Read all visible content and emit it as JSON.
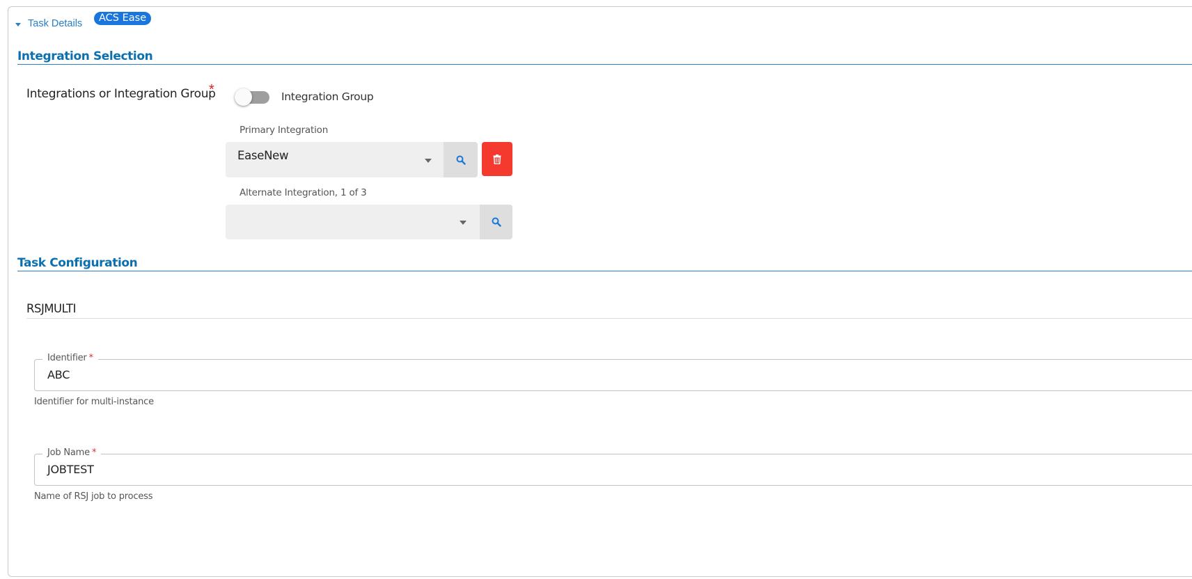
{
  "task_details": {
    "label": "Task Details",
    "badge": "ACS Ease",
    "icon": "caret-down-icon"
  },
  "integration_selection": {
    "title": "Integration Selection",
    "field_label": "Integrations or Integration Group",
    "required_mark": "*",
    "toggle_label": "Integration Group",
    "toggle_on": false,
    "primary": {
      "label": "Primary Integration",
      "value": "EaseNew"
    },
    "alternate": {
      "label": "Alternate Integration, 1 of 3",
      "value": ""
    }
  },
  "task_configuration": {
    "title": "Task Configuration",
    "group_title": "RSJMULTI",
    "fields": [
      {
        "label": "Identifier",
        "required_mark": "*",
        "value": "ABC",
        "helper": "Identifier for multi-instance"
      },
      {
        "label": "Job Name",
        "required_mark": "*",
        "value": "JOBTEST",
        "helper": "Name of RSJ job to process"
      }
    ]
  },
  "colors": {
    "accent": "#0b6fb0",
    "badge": "#1a76dc",
    "delete": "#f4392e",
    "required": "#e01b1b"
  }
}
